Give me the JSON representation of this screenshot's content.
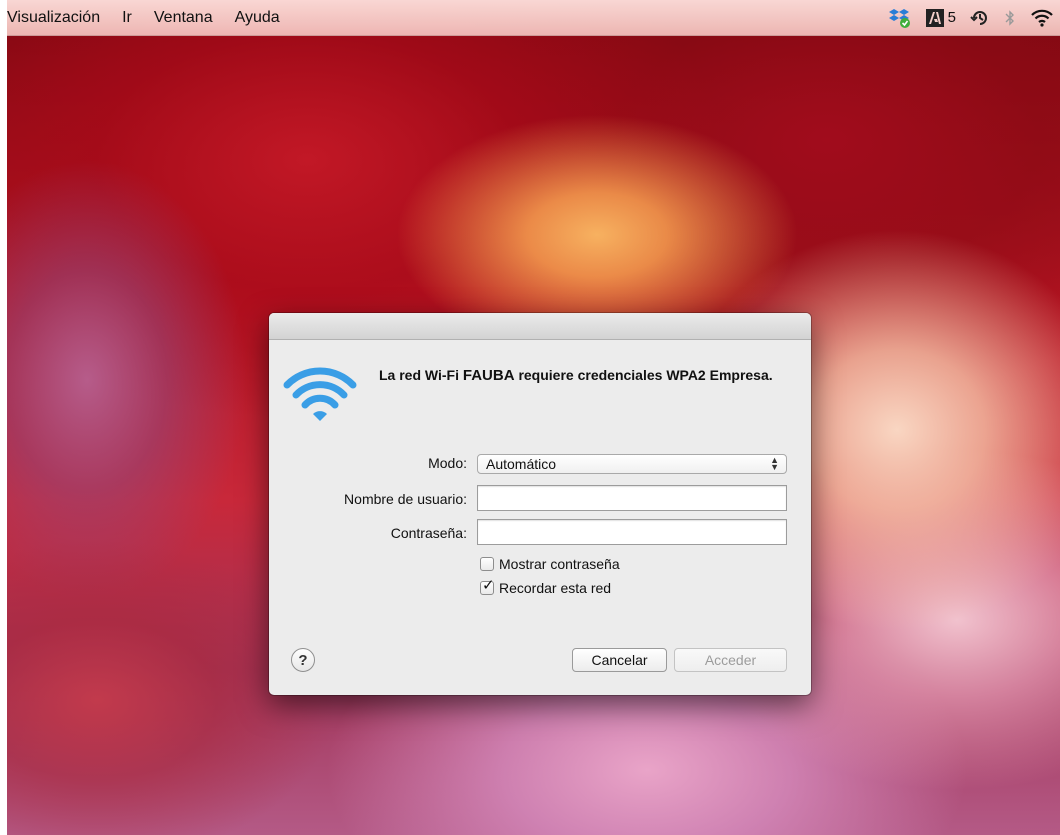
{
  "menubar": {
    "items": [
      "Visualización",
      "Ir",
      "Ventana",
      "Ayuda"
    ],
    "status": {
      "adobe_count": "5",
      "icons": [
        "dropbox-sync-icon",
        "adobe-icon",
        "time-machine-icon",
        "bluetooth-icon",
        "wifi-icon"
      ]
    }
  },
  "dialog": {
    "message_prefix": "La red Wi-Fi ",
    "network_name": "FAUBA",
    "message_suffix": " requiere credenciales WPA2 Empresa.",
    "mode_label": "Modo:",
    "mode_value": "Automático",
    "username_label": "Nombre de usuario:",
    "username_value": "",
    "password_label": "Contraseña:",
    "password_value": "",
    "show_password_label": "Mostrar contraseña",
    "show_password_checked": false,
    "remember_label": "Recordar esta red",
    "remember_checked": true,
    "help_label": "?",
    "cancel_label": "Cancelar",
    "accept_label": "Acceder"
  },
  "colors": {
    "wifi_blue": "#3a9ee6",
    "dialog_bg": "#ececec",
    "disabled_text": "#9c9c9c"
  }
}
